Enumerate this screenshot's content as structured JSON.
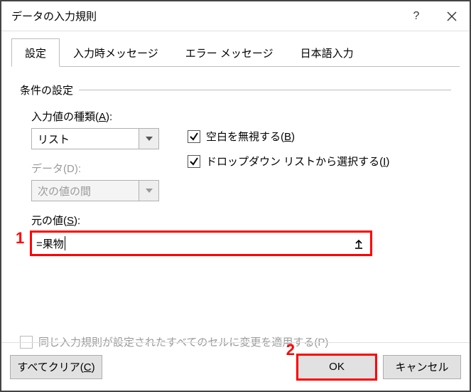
{
  "window": {
    "title": "データの入力規則"
  },
  "tabs": {
    "settings": "設定",
    "input_message": "入力時メッセージ",
    "error_message": "エラー メッセージ",
    "ime": "日本語入力"
  },
  "group": {
    "title": "条件の設定"
  },
  "allow": {
    "label_prefix": "入力値の種類(",
    "label_key": "A",
    "label_suffix": "):",
    "value": "リスト"
  },
  "data": {
    "label_prefix": "データ(",
    "label_key": "D",
    "label_suffix": "):",
    "value": "次の値の間"
  },
  "ignore_blank": {
    "label_prefix": "空白を無視する(",
    "label_key": "B",
    "label_suffix": ")"
  },
  "dropdown": {
    "label_prefix": "ドロップダウン リストから選択する(",
    "label_key": "I",
    "label_suffix": ")"
  },
  "source": {
    "label_prefix": "元の値(",
    "label_key": "S",
    "label_suffix": "):",
    "value": "=果物"
  },
  "apply_all": {
    "label_prefix": "同じ入力規則が設定されたすべてのセルに変更を適用する(",
    "label_key": "P",
    "label_suffix": ")"
  },
  "buttons": {
    "clear_prefix": "すべてクリア(",
    "clear_key": "C",
    "clear_suffix": ")",
    "ok": "OK",
    "cancel": "キャンセル"
  },
  "annotations": {
    "one": "1",
    "two": "2"
  }
}
